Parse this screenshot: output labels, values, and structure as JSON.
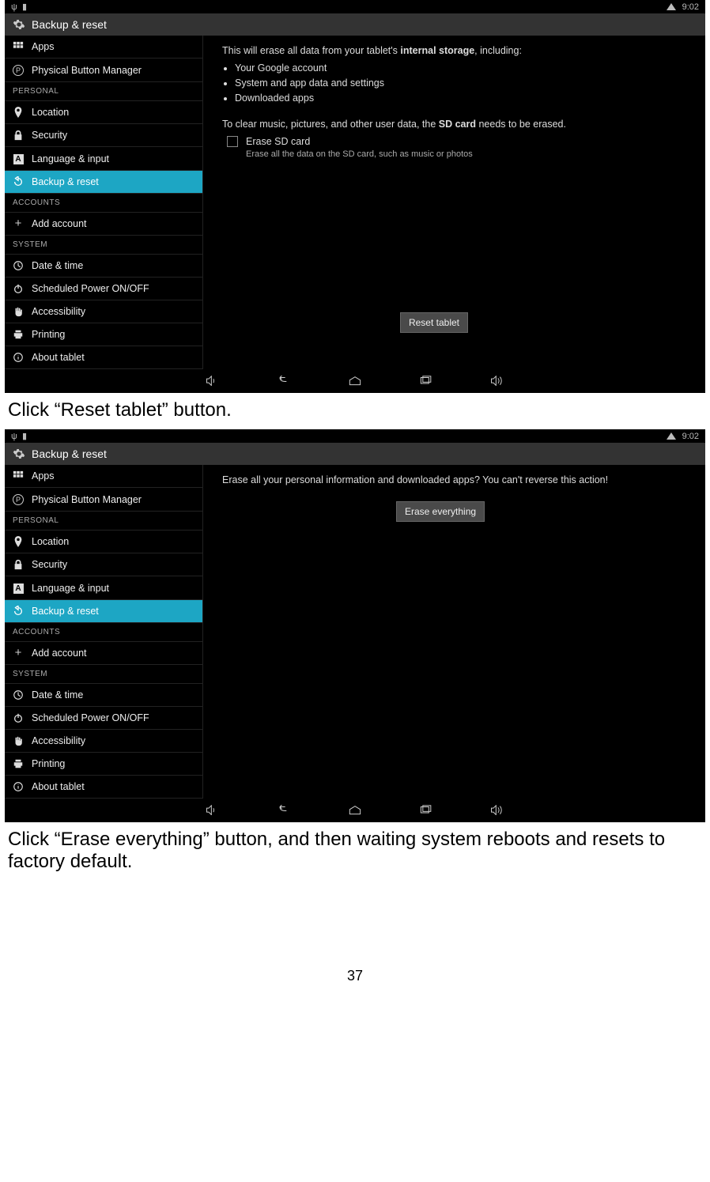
{
  "shots": [
    {
      "status": {
        "time": "9:02"
      },
      "title": "Backup & reset",
      "sidebar": {
        "items": [
          {
            "icon": "apps",
            "label": "Apps"
          },
          {
            "icon": "P",
            "label": "Physical Button Manager"
          }
        ],
        "sec_personal": "PERSONAL",
        "personal": [
          {
            "icon": "loc",
            "label": "Location"
          },
          {
            "icon": "lock",
            "label": "Security"
          },
          {
            "icon": "A",
            "label": "Language & input"
          },
          {
            "icon": "restore",
            "label": "Backup & reset",
            "selected": true
          }
        ],
        "sec_accounts": "ACCOUNTS",
        "accounts": [
          {
            "icon": "plus",
            "label": "Add account"
          }
        ],
        "sec_system": "SYSTEM",
        "system": [
          {
            "icon": "clock",
            "label": "Date & time"
          },
          {
            "icon": "power",
            "label": "Scheduled Power ON/OFF"
          },
          {
            "icon": "hand",
            "label": "Accessibility"
          },
          {
            "icon": "print",
            "label": "Printing"
          },
          {
            "icon": "info",
            "label": "About tablet"
          }
        ]
      },
      "content": {
        "line1_a": "This will erase all data from your tablet's ",
        "line1_b": "internal storage",
        "line1_c": ", including:",
        "bullets": [
          "Your Google account",
          "System and app data and settings",
          "Downloaded apps"
        ],
        "line2_a": "To clear music, pictures, and other user data, the ",
        "line2_b": "SD card",
        "line2_c": " needs to be erased.",
        "chk_label": "Erase SD card",
        "chk_sub": "Erase all the data on the SD card, such as music or photos",
        "button": "Reset tablet"
      }
    },
    {
      "status": {
        "time": "9:02"
      },
      "title": "Backup & reset",
      "sidebar": "same",
      "content": {
        "line": "Erase all your personal information and downloaded apps? You can't reverse this action!",
        "button": "Erase everything"
      }
    }
  ],
  "captions": {
    "c1": "Click “Reset tablet” button.",
    "c2": "Click “Erase everything” button, and then waiting system reboots and resets to factory default."
  },
  "page_number": "37"
}
